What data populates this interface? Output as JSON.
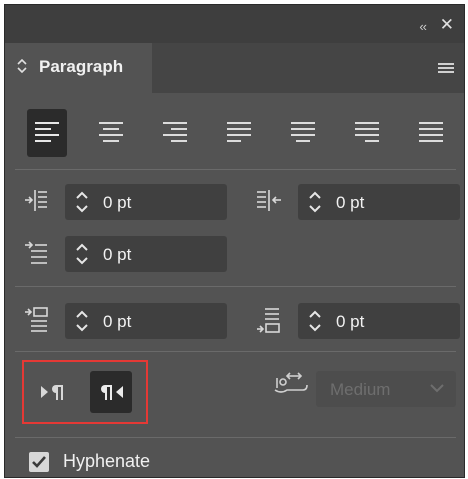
{
  "window": {
    "collapse_glyph": "‹‹",
    "close_glyph": "✕"
  },
  "panel": {
    "tab_label": "Paragraph",
    "tab_icon": "chevron-updown-icon",
    "menu_icon": "hamburger-menu-icon"
  },
  "alignment": {
    "buttons": [
      {
        "name": "align-left",
        "active": true
      },
      {
        "name": "align-center",
        "active": false
      },
      {
        "name": "align-right",
        "active": false
      },
      {
        "name": "justify-last-left",
        "active": false
      },
      {
        "name": "justify-last-center",
        "active": false
      },
      {
        "name": "justify-last-right",
        "active": false
      },
      {
        "name": "justify-all",
        "active": false
      }
    ]
  },
  "indents": {
    "left_indent": "0 pt",
    "right_indent": "0 pt",
    "first_line_indent": "0 pt"
  },
  "spacing": {
    "space_before": "0 pt",
    "space_after": "0 pt"
  },
  "direction": {
    "ltr_icon": "ltr-paragraph-icon",
    "rtl_icon": "rtl-paragraph-icon",
    "active": "rtl"
  },
  "kashida": {
    "icon": "kashida-icon",
    "value": "Medium",
    "disabled": true
  },
  "hyphenate": {
    "label": "Hyphenate",
    "checked": true
  },
  "colors": {
    "panel_bg": "#535353",
    "field_bg": "#404040",
    "active_bg": "#2b2b2b",
    "highlight_border": "#e53935"
  }
}
